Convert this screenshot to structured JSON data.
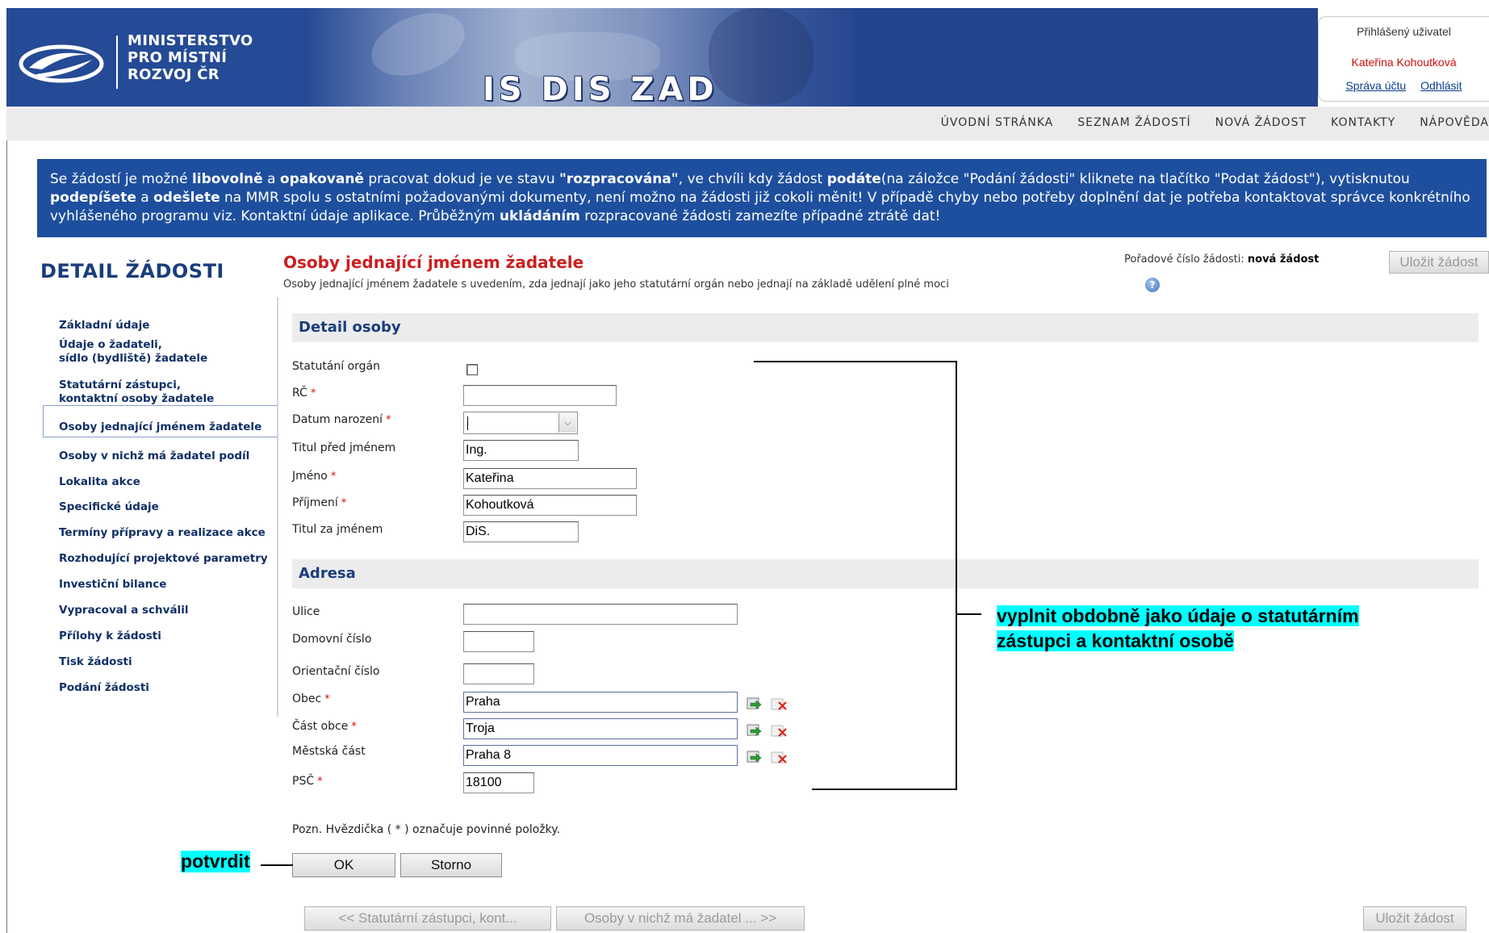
{
  "header": {
    "ministry_lines": [
      "MINISTERSTVO",
      "PRO MÍSTNÍ",
      "ROZVOJ ČR"
    ],
    "app_title": "IS DIS ZAD",
    "user_label": "Přihlášený uživatel",
    "user_name": "Kateřina Kohoutková",
    "account_link": "Správa účtu",
    "logout_link": "Odhlásit"
  },
  "nav": {
    "items": [
      "ÚVODNÍ STRÁNKA",
      "SEZNAM ŽÁDOSTÍ",
      "NOVÁ ŽÁDOST",
      "KONTAKTY",
      "NÁPOVĚDA"
    ]
  },
  "info": {
    "parts": [
      {
        "text": "Se žádostí je možné ",
        "bold": false
      },
      {
        "text": "libovolně",
        "bold": true
      },
      {
        "text": " a ",
        "bold": false
      },
      {
        "text": "opakovaně",
        "bold": true
      },
      {
        "text": " pracovat dokud je ve stavu ",
        "bold": false
      },
      {
        "text": "\"rozpracována\"",
        "bold": true
      },
      {
        "text": ", ve chvíli kdy žádost ",
        "bold": false
      },
      {
        "text": "podáte",
        "bold": true
      },
      {
        "text": "(na záložce \"Podání žádosti\" kliknete na tlačítko \"Podat žádost\"), vytisknutou ",
        "bold": false
      },
      {
        "text": "podepíšete",
        "bold": true
      },
      {
        "text": " a ",
        "bold": false
      },
      {
        "text": "odešlete",
        "bold": true
      },
      {
        "text": " na MMR spolu s ostatními požadovanými dokumenty, není možno na žádosti již cokoli měnit! V případě chyby nebo potřeby doplnění dat je potřeba kontaktovat správce konkrétního vyhlášeného programu viz. Kontaktní údaje aplikace. Průběžným ",
        "bold": false
      },
      {
        "text": "ukládáním",
        "bold": true
      },
      {
        "text": " rozpracované žádosti zamezíte případné ztrátě dat!",
        "bold": false
      }
    ]
  },
  "sidebar": {
    "title": "DETAIL ŽÁDOSTI",
    "items": [
      {
        "label": "Základní údaje"
      },
      {
        "label": "Údaje o žadateli,\nsídlo (bydliště) žadatele"
      },
      {
        "label": "Statutární zástupci,\nkontaktní osoby žadatele"
      },
      {
        "label": "Osoby jednající jménem žadatele",
        "active": true
      },
      {
        "label": "Osoby v nichž má žadatel podíl"
      },
      {
        "label": "Lokalita akce"
      },
      {
        "label": "Specifické údaje"
      },
      {
        "label": "Termíny přípravy a realizace akce"
      },
      {
        "label": "Rozhodující projektové parametry"
      },
      {
        "label": "Investiční bilance"
      },
      {
        "label": "Vypracoval a schválil"
      },
      {
        "label": "Přílohy k žádosti"
      },
      {
        "label": "Tisk žádosti"
      },
      {
        "label": "Podání žádosti"
      }
    ]
  },
  "main": {
    "title": "Osoby jednající jménem žadatele",
    "subtitle": "Osoby jednající jménem žadatele s uvedením, zda jednají jako jeho statutární orgán nebo jednají na základě udělení plné moci",
    "order_label": "Pořadové číslo žádosti: ",
    "order_value": "nová žádost",
    "save_label": "Uložit žádost",
    "person_section": "Detail osoby",
    "address_section": "Adresa",
    "fields": {
      "statutarni": {
        "label": "Statutání orgán",
        "checked": false
      },
      "rc": {
        "label": "RČ",
        "value": ""
      },
      "datum": {
        "label": "Datum narození",
        "value": ""
      },
      "titul_pred": {
        "label": "Titul před jménem",
        "value": "Ing."
      },
      "jmeno": {
        "label": "Jméno",
        "value": "Kateřina"
      },
      "prijmeni": {
        "label": "Příjmení",
        "value": "Kohoutková"
      },
      "titul_za": {
        "label": "Titul za jménem",
        "value": "DiS."
      },
      "ulice": {
        "label": "Ulice",
        "value": ""
      },
      "domovni": {
        "label": "Domovní číslo",
        "value": ""
      },
      "orientacni": {
        "label": "Orientační číslo",
        "value": ""
      },
      "obec": {
        "label": "Obec",
        "value": "Praha"
      },
      "cast_obce": {
        "label": "Část obce",
        "value": "Troja"
      },
      "mestska_cast": {
        "label": "Městská část",
        "value": "Praha 8"
      },
      "psc": {
        "label": "PSČ",
        "value": "18100"
      }
    },
    "required_mark": "*",
    "note": "Pozn. Hvězdička ( * ) označuje povinné položky.",
    "ok_label": "OK",
    "storno_label": "Storno",
    "prev_label": "<< Statutární zástupci, kont...",
    "next_label": "Osoby v nichž má žadatel ... >>"
  },
  "annotations": {
    "callout_text": "vyplnit obdobně jako údaje o statutárním zástupci a kontaktní osobě",
    "confirm_text": "potvrdit"
  },
  "colors": {
    "banner": "#254a96",
    "info_bg": "#1e4f9e",
    "title_red": "#cc1f1f",
    "highlight": "#00ffff"
  }
}
